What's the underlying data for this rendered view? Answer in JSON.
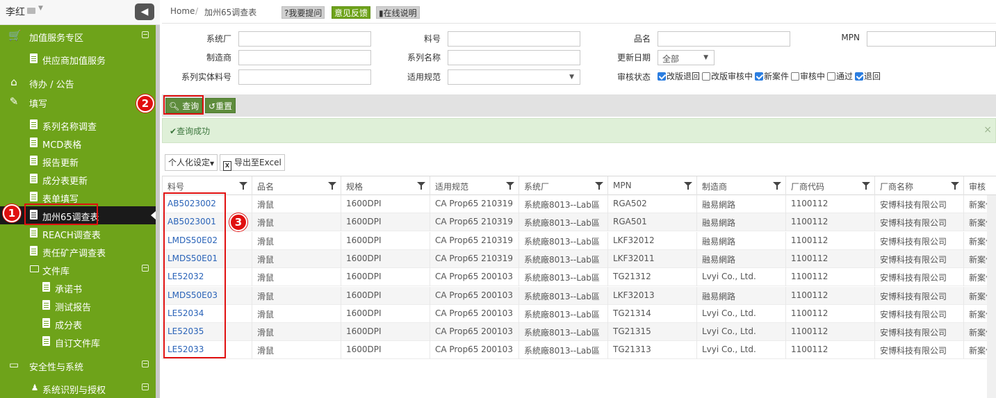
{
  "sidebar": {
    "username": "李红",
    "collapse_icon": "arrow-left-icon",
    "sections": [
      {
        "label": "加值服务专区",
        "icon": "cart-icon"
      },
      {
        "label": "待办 / 公告",
        "icon": "home-icon"
      },
      {
        "label": "填写",
        "icon": "edit-icon"
      },
      {
        "label": "安全性与系统",
        "icon": "monitor-icon"
      }
    ],
    "items": {
      "vas_supplier": "供应商加值服务",
      "series_survey": "系列名称调查",
      "mcd": "MCD表格",
      "report_update": "报告更新",
      "composition_update": "成分表更新",
      "form_fill": "表单填写",
      "ca65": "加州65调查表",
      "reach": "REACH调查表",
      "conflict": "责任矿产调查表",
      "library": "文件库",
      "commitment": "承诺书",
      "test_report": "测试报告",
      "composition": "成分表",
      "custom_docs": "自订文件库",
      "sys_auth": "系统识别与授权"
    }
  },
  "callouts": [
    "1",
    "2",
    "3"
  ],
  "breadcrumb": {
    "home": "Home",
    "sep": "/",
    "current": "加州65调查表",
    "ask": "?我要提问",
    "feedback": "意见反馈",
    "help": "在线说明"
  },
  "filters": {
    "system_factory": "系统厂",
    "part_no": "料号",
    "product_name": "品名",
    "mpn": "MPN",
    "manufacturer": "制造商",
    "series_name": "系列名称",
    "update_date": "更新日期",
    "update_date_value": "全部",
    "series_part": "系列实体料号",
    "applicable_spec": "适用规范",
    "review_status": "审核状态",
    "statuses": [
      {
        "label": "改版退回",
        "checked": true
      },
      {
        "label": "改版审核中",
        "checked": false
      },
      {
        "label": "新案件",
        "checked": true
      },
      {
        "label": "审核中",
        "checked": false
      },
      {
        "label": "通过",
        "checked": false
      },
      {
        "label": "退回",
        "checked": true
      }
    ]
  },
  "toolbar": {
    "query": "查询",
    "reset": "重置"
  },
  "alert": {
    "message": "查询成功",
    "close": "×"
  },
  "grid_tools": {
    "personalize": "个人化设定",
    "export": "导出至Excel"
  },
  "table": {
    "columns": [
      "料号",
      "品名",
      "规格",
      "适用规范",
      "系统厂",
      "MPN",
      "制造商",
      "厂商代码",
      "厂商名称",
      "审核"
    ],
    "rows": [
      [
        "AB5023002",
        "滑鼠",
        "1600DPI",
        "CA Prop65 210319",
        "系統廠8013--Lab區",
        "RGA502",
        "融易網路",
        "1100112",
        "安博科技有限公司",
        "新案件"
      ],
      [
        "AB5023001",
        "滑鼠",
        "1600DPI",
        "CA Prop65 210319",
        "系統廠8013--Lab區",
        "RGA501",
        "融易網路",
        "1100112",
        "安博科技有限公司",
        "新案件"
      ],
      [
        "LMDS50E02",
        "滑鼠",
        "1600DPI",
        "CA Prop65 210319",
        "系統廠8013--Lab區",
        "LKF32012",
        "融易網路",
        "1100112",
        "安博科技有限公司",
        "新案件"
      ],
      [
        "LMDS50E01",
        "滑鼠",
        "1600DPI",
        "CA Prop65 210319",
        "系統廠8013--Lab區",
        "LKF32011",
        "融易網路",
        "1100112",
        "安博科技有限公司",
        "新案件"
      ],
      [
        "LE52032",
        "滑鼠",
        "1600DPI",
        "CA Prop65 200103",
        "系統廠8013--Lab區",
        "TG21312",
        "Lvyi Co., Ltd.",
        "1100112",
        "安博科技有限公司",
        "新案件"
      ],
      [
        "LMDS50E03",
        "滑鼠",
        "1600DPI",
        "CA Prop65 200103",
        "系統廠8013--Lab區",
        "LKF32013",
        "融易網路",
        "1100112",
        "安博科技有限公司",
        "新案件"
      ],
      [
        "LE52034",
        "滑鼠",
        "1600DPI",
        "CA Prop65 200103",
        "系統廠8013--Lab區",
        "TG21314",
        "Lvyi Co., Ltd.",
        "1100112",
        "安博科技有限公司",
        "新案件"
      ],
      [
        "LE52035",
        "滑鼠",
        "1600DPI",
        "CA Prop65 200103",
        "系統廠8013--Lab區",
        "TG21315",
        "Lvyi Co., Ltd.",
        "1100112",
        "安博科技有限公司",
        "新案件"
      ],
      [
        "LE52033",
        "滑鼠",
        "1600DPI",
        "CA Prop65 200103",
        "系統廠8013--Lab區",
        "TG21313",
        "Lvyi Co., Ltd.",
        "1100112",
        "安博科技有限公司",
        "新案件"
      ]
    ]
  },
  "colors": {
    "sidebar_bg": "#6ea31a",
    "active_item_bg": "#1a1a1a",
    "callout_red": "#e01010",
    "link_blue": "#2a63b8",
    "alert_bg": "#dff0d8"
  }
}
